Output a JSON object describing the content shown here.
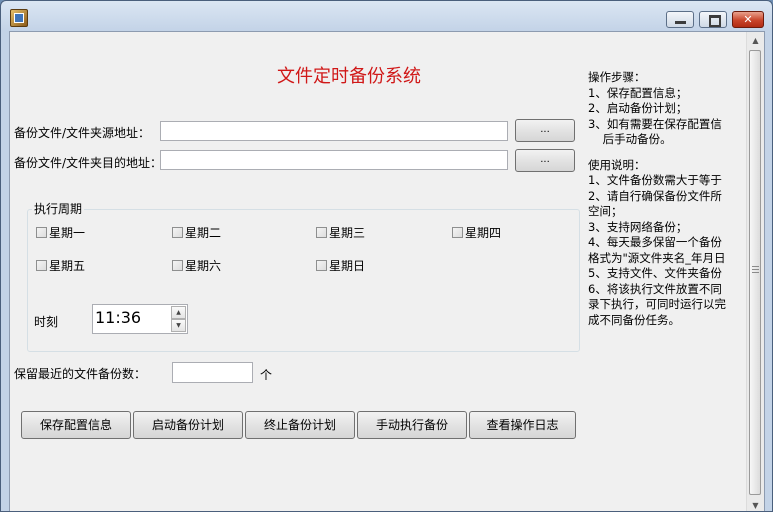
{
  "window": {
    "title": ""
  },
  "app": {
    "heading": "文件定时备份系统"
  },
  "form": {
    "source_label": "备份文件/文件夹源地址：",
    "source_value": "",
    "dest_label": "备份文件/文件夹目的地址：",
    "dest_value": "",
    "browse_label": "...",
    "schedule_group_title": "执行周期",
    "weekdays": [
      "星期一",
      "星期二",
      "星期三",
      "星期四",
      "星期五",
      "星期六",
      "星期日"
    ],
    "time_label": "时刻",
    "time_value": "11:36",
    "keep_label": "保留最近的文件备份数：",
    "keep_value": "",
    "keep_unit": "个"
  },
  "buttons": {
    "save": "保存配置信息",
    "start": "启动备份计划",
    "stop": "终止备份计划",
    "manual": "手动执行备份",
    "log": "查看操作日志"
  },
  "instructions": {
    "steps_title": "操作步骤：",
    "steps": [
      "1、保存配置信息；",
      "2、启动备份计划；",
      "3、如有需要在保存配置信",
      "    后手动备份。"
    ],
    "usage_title": "使用说明：",
    "usage": [
      "1、文件备份数需大于等于",
      "2、请自行确保备份文件所",
      "空间；",
      "3、支持网络备份；",
      "4、每天最多保留一个备份",
      "格式为\"源文件夹名_年月日",
      "5、支持文件、文件夹备份",
      "6、将该执行文件放置不同",
      "录下执行，可同时运行以完",
      "成不同备份任务。"
    ]
  }
}
